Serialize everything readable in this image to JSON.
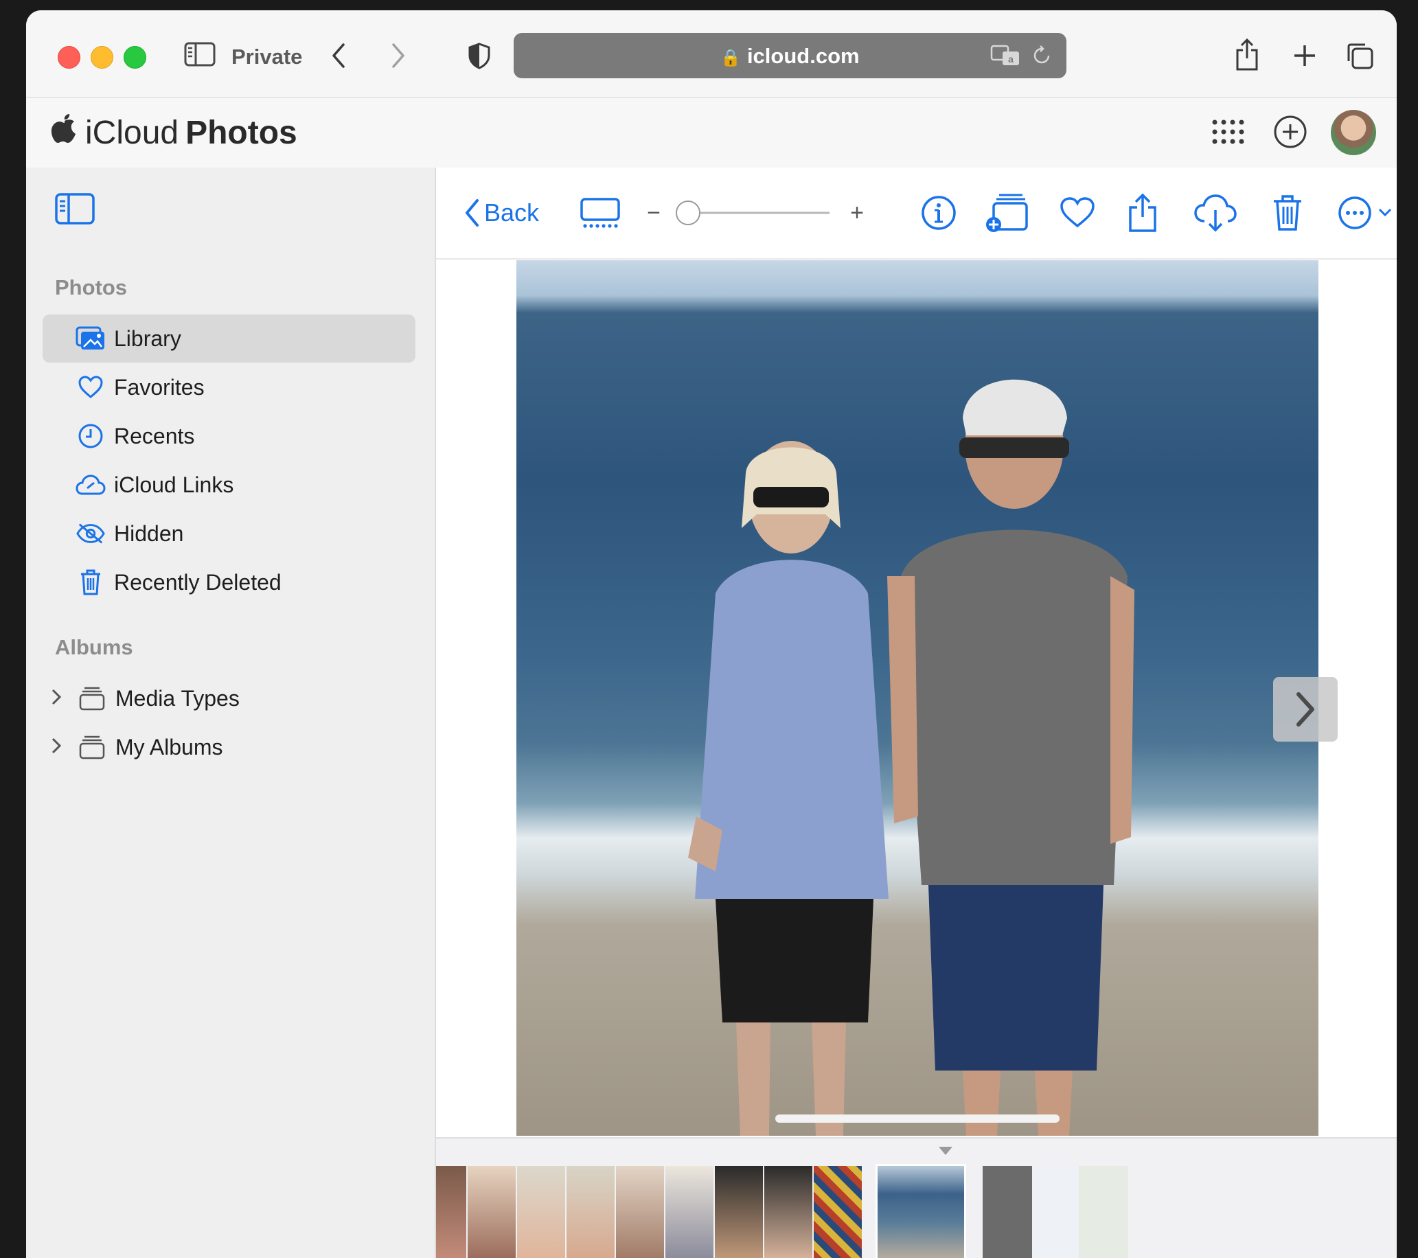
{
  "browser": {
    "mode_label": "Private",
    "url": "icloud.com",
    "colors": {
      "close": "#fe5f57",
      "minimize": "#febc2e",
      "zoom": "#28c840"
    }
  },
  "app": {
    "brand_prefix": "iCloud",
    "brand_name": "Photos",
    "accent_color": "#1a73e8"
  },
  "sidebar": {
    "photos_header": "Photos",
    "items": [
      {
        "label": "Library",
        "icon": "library-icon",
        "selected": true
      },
      {
        "label": "Favorites",
        "icon": "heart-icon"
      },
      {
        "label": "Recents",
        "icon": "clock-icon"
      },
      {
        "label": "iCloud Links",
        "icon": "cloud-link-icon"
      },
      {
        "label": "Hidden",
        "icon": "eye-slash-icon"
      },
      {
        "label": "Recently Deleted",
        "icon": "trash-icon"
      }
    ],
    "albums_header": "Albums",
    "albums": [
      {
        "label": "Media Types",
        "icon": "album-stack-icon"
      },
      {
        "label": "My Albums",
        "icon": "album-stack-icon"
      }
    ]
  },
  "viewer": {
    "back_label": "Back",
    "zoom_minus": "−",
    "zoom_plus": "+",
    "zoom_level": 0.0,
    "icons": [
      "slideshow-icon",
      "info-icon",
      "add-to-album-icon",
      "favorite-icon",
      "share-icon",
      "download-icon",
      "delete-icon",
      "more-icon"
    ]
  }
}
